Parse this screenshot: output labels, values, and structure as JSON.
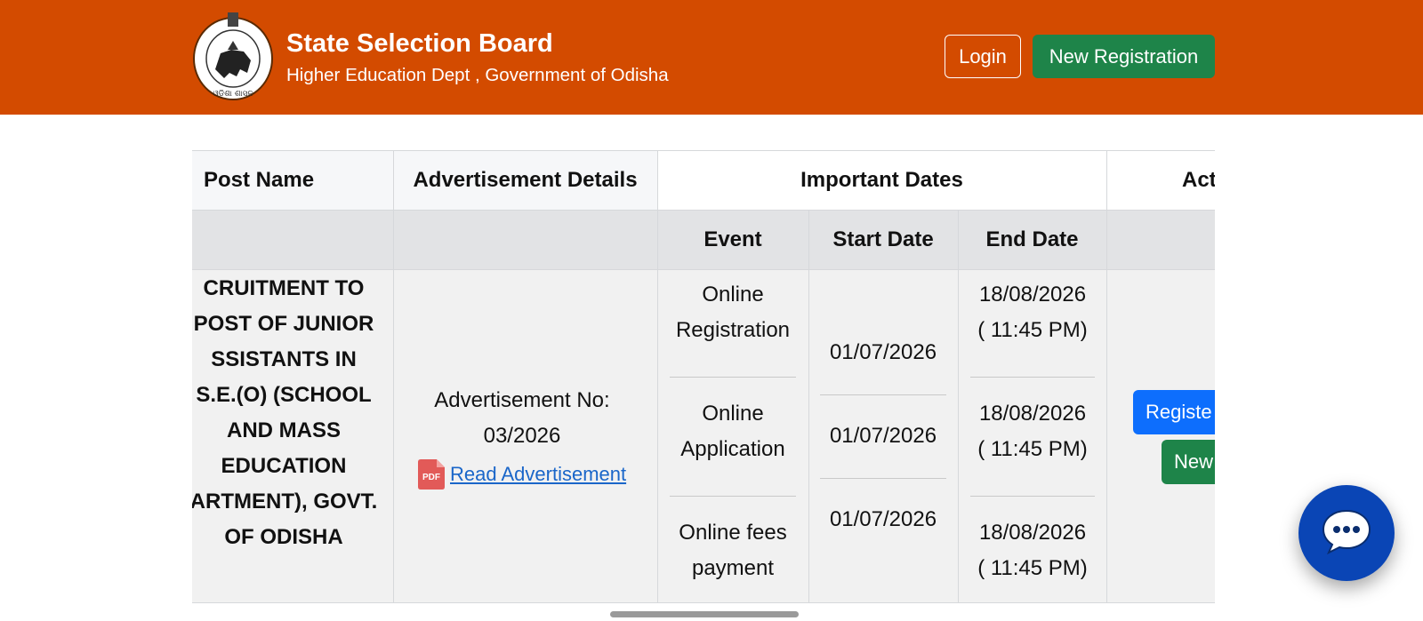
{
  "header": {
    "title": "State Selection Board",
    "subtitle": "Higher Education Dept , Government of Odisha",
    "emblem_icon": "odisha-emblem-icon",
    "login_label": "Login",
    "new_registration_label": "New Registration",
    "background_color": "#d34b00"
  },
  "table": {
    "columns": {
      "post_name": "Post Name",
      "advertisement_details": "Advertisement Details",
      "important_dates": "Important Dates",
      "action_partial": "Act"
    },
    "subcolumns": {
      "event": "Event",
      "start_date": "Start Date",
      "end_date": "End Date"
    },
    "row": {
      "post_name_lines": [
        "CRUITMENT TO",
        "POST OF JUNIOR",
        "SSISTANTS IN",
        "S.E.(O) (SCHOOL",
        "AND MASS",
        "EDUCATION",
        "ARTMENT), GOVT.",
        "OF ODISHA"
      ],
      "advertisement_no_label": "Advertisement No:",
      "advertisement_no": "03/2026",
      "read_advertisement": "Read Advertisement",
      "pdf_badge": "PDF",
      "events": [
        {
          "line1": "Online",
          "line2": "Registration",
          "start": "01/07/2026",
          "end_date": "18/08/2026",
          "end_time": "( 11:45 PM)"
        },
        {
          "line1": "Online",
          "line2": "Application",
          "start": "01/07/2026",
          "end_date": "18/08/2026",
          "end_time": "( 11:45 PM)"
        },
        {
          "line1": "Online fees",
          "line2": "payment",
          "start": "01/07/2026",
          "end_date": "18/08/2026",
          "end_time": "( 11:45 PM)"
        }
      ],
      "register_button": "Registe",
      "new_button": "New"
    }
  },
  "chat": {
    "icon": "chat-bubble-icon",
    "color": "#0a45b5"
  }
}
